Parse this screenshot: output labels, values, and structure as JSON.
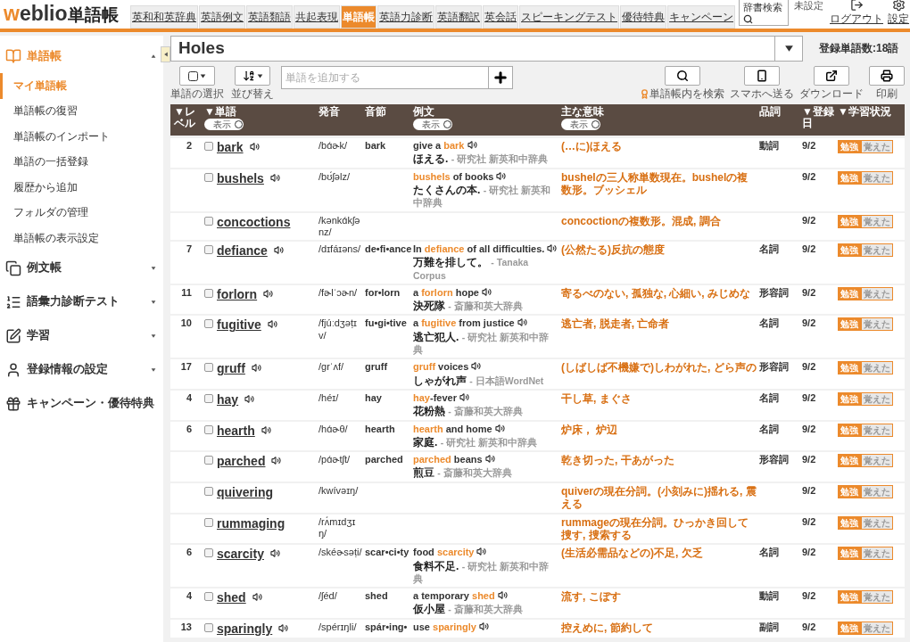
{
  "header": {
    "logo": {
      "accent": "w",
      "rest": "eblio",
      "suffix": "単語帳"
    },
    "tabs": [
      {
        "label": "英和和英辞典",
        "selected": false
      },
      {
        "label": "英語例文",
        "selected": false
      },
      {
        "label": "英語類語",
        "selected": false
      },
      {
        "label": "共起表現",
        "selected": false
      },
      {
        "label": "単語帳",
        "selected": true
      },
      {
        "label": "英語力診断",
        "selected": false
      },
      {
        "label": "英語翻訳",
        "selected": false
      },
      {
        "label": "英会話",
        "selected": false
      },
      {
        "label": "スピーキングテスト",
        "selected": false
      },
      {
        "label": "優待特典",
        "selected": false
      },
      {
        "label": "キャンペーン",
        "selected": false
      }
    ],
    "search_label": "辞書検索",
    "user": "未設定",
    "logout": "ログアウト",
    "settings": "設定"
  },
  "sidebar": {
    "sections": [
      {
        "label": "単語帳",
        "expanded": true,
        "items": [
          {
            "label": "マイ単語帳",
            "selected": true
          },
          {
            "label": "単語帳の復習",
            "selected": false
          },
          {
            "label": "単語帳のインポート",
            "selected": false
          },
          {
            "label": "単語の一括登録",
            "selected": false
          },
          {
            "label": "履歴から追加",
            "selected": false
          },
          {
            "label": "フォルダの管理",
            "selected": false
          },
          {
            "label": "単語帳の表示設定",
            "selected": false
          }
        ]
      },
      {
        "label": "例文帳",
        "expanded": false
      },
      {
        "label": "語彙力診断テスト",
        "expanded": false
      },
      {
        "label": "学習",
        "expanded": false
      },
      {
        "label": "登録情報の設定",
        "expanded": false
      },
      {
        "label": "キャンペーン・優待特典",
        "expanded": false
      }
    ]
  },
  "wordbook": {
    "name": "Holes",
    "count": "登録単語数:18語"
  },
  "toolbar": {
    "select_label": "単語の選択",
    "sort_label": "並び替え",
    "add_placeholder": "単語を追加する",
    "actions": [
      {
        "kind": "search",
        "label": "単語帳内を検索"
      },
      {
        "kind": "phone",
        "label": "スマホへ送る"
      },
      {
        "kind": "download",
        "label": "ダウンロード"
      },
      {
        "kind": "print",
        "label": "印刷"
      }
    ]
  },
  "table": {
    "columns": [
      {
        "label": "▼レベル"
      },
      {
        "label": "▼単語",
        "toggle": "表示",
        "toggle_on": true
      },
      {
        "label": "発音"
      },
      {
        "label": "音節"
      },
      {
        "label": "例文",
        "toggle": "表示",
        "toggle_on": true
      },
      {
        "label": "主な意味",
        "toggle": "表示",
        "toggle_on": true
      },
      {
        "label": "品詞"
      },
      {
        "label": "▼登録日"
      },
      {
        "label": "▼学習状況"
      }
    ],
    "rows": [
      {
        "level": "2",
        "word": "bark",
        "checked": false,
        "audio": true,
        "pron": "/bɑ́ɚk/",
        "syll": "bark",
        "example": {
          "before": "give a ",
          "hit": "bark",
          "translation": "ほえる.",
          "source": "- 研究社 新英和中辞典"
        },
        "meaning": "(…に)ほえる",
        "pos": "動詞",
        "date": "9/2",
        "status": [
          {
            "label": "勉強",
            "selected": true
          },
          {
            "label": "覚えた",
            "selected": false
          }
        ]
      },
      {
        "word": "bushels",
        "checked": false,
        "audio": true,
        "pron": "/bʊ́ʃəlz/",
        "example": {
          "hit": "bushels",
          "after": " of books",
          "translation": "たくさんの本.",
          "source": "- 研究社 新英和中辞典"
        },
        "meaning": "bushelの三人称単数現在。bushelの複数形。ブッシェル",
        "date": "9/2",
        "status": [
          {
            "label": "勉強",
            "selected": true
          },
          {
            "label": "覚えた",
            "selected": false
          }
        ]
      },
      {
        "word": "concoctions",
        "checked": false,
        "audio": false,
        "pron": "/kənkɑ́kʃənz/",
        "meaning": "concoctionの複数形。混成, 調合",
        "date": "9/2",
        "status": [
          {
            "label": "勉強",
            "selected": true
          },
          {
            "label": "覚えた",
            "selected": false
          }
        ]
      },
      {
        "level": "7",
        "word": "defiance",
        "checked": false,
        "audio": true,
        "pron": "/dɪfáɪəns/",
        "syll": "de•fi•ance",
        "example": {
          "before": "In ",
          "hit": "defiance",
          "after": " of all difficulties.",
          "translation": "万難を排して。",
          "source": "- Tanaka Corpus"
        },
        "meaning": "(公然たる)反抗の態度",
        "pos": "名詞",
        "date": "9/2",
        "status": [
          {
            "label": "勉強",
            "selected": true
          },
          {
            "label": "覚えた",
            "selected": false
          }
        ]
      },
      {
        "level": "11",
        "word": "forlorn",
        "checked": false,
        "audio": true,
        "pron": "/fɚlˈɔɚn/",
        "syll": "for•lorn",
        "example": {
          "before": "a ",
          "hit": "forlorn",
          "after": " hope",
          "translation": "決死隊",
          "source": "- 斎藤和英大辞典"
        },
        "meaning": "寄るべのない, 孤独な, 心細い, みじめな",
        "pos": "形容詞",
        "date": "9/2",
        "status": [
          {
            "label": "勉強",
            "selected": true
          },
          {
            "label": "覚えた",
            "selected": false
          }
        ]
      },
      {
        "level": "10",
        "word": "fugitive",
        "checked": false,
        "audio": true,
        "pron": "/fjúːdʒəṭɪv/",
        "syll": "fu•gi•tive",
        "example": {
          "before": "a ",
          "hit": "fugitive",
          "after": " from justice",
          "translation": "逃亡犯人.",
          "source": "- 研究社 新英和中辞典"
        },
        "meaning": "逃亡者, 脱走者, 亡命者",
        "pos": "名詞",
        "date": "9/2",
        "status": [
          {
            "label": "勉強",
            "selected": true
          },
          {
            "label": "覚えた",
            "selected": false
          }
        ]
      },
      {
        "level": "17",
        "word": "gruff",
        "checked": false,
        "audio": true,
        "pron": "/grˈʌf/",
        "syll": "gruff",
        "example": {
          "hit": "gruff",
          "after": " voices",
          "translation": "しゃがれ声",
          "source": "- 日本語WordNet"
        },
        "meaning": "(しばしば不機嫌で)しわがれた, どら声の",
        "pos": "形容詞",
        "date": "9/2",
        "status": [
          {
            "label": "勉強",
            "selected": true
          },
          {
            "label": "覚えた",
            "selected": false
          }
        ]
      },
      {
        "level": "4",
        "word": "hay",
        "checked": false,
        "audio": true,
        "pron": "/héɪ/",
        "syll": "hay",
        "example": {
          "hit": "hay",
          "after": "-fever",
          "translation": "花粉熱",
          "source": "- 斎藤和英大辞典"
        },
        "meaning": "干し草, まぐさ",
        "pos": "名詞",
        "date": "9/2",
        "status": [
          {
            "label": "勉強",
            "selected": true
          },
          {
            "label": "覚えた",
            "selected": false
          }
        ]
      },
      {
        "level": "6",
        "word": "hearth",
        "checked": false,
        "audio": true,
        "pron": "/hɑ́ɚθ/",
        "syll": "hearth",
        "example": {
          "hit": "hearth",
          "after": " and home",
          "translation": "家庭.",
          "source": "- 研究社 新英和中辞典"
        },
        "meaning": "炉床， 炉辺",
        "pos": "名詞",
        "date": "9/2",
        "status": [
          {
            "label": "勉強",
            "selected": true
          },
          {
            "label": "覚えた",
            "selected": false
          }
        ]
      },
      {
        "word": "parched",
        "checked": false,
        "audio": true,
        "pron": "/pɑ́ɚtʃt/",
        "syll": "parched",
        "example": {
          "hit": "parched",
          "after": " beans",
          "translation": "煎豆",
          "source": "- 斎藤和英大辞典"
        },
        "meaning": "乾き切った, 干あがった",
        "pos": "形容詞",
        "date": "9/2",
        "status": [
          {
            "label": "勉強",
            "selected": true
          },
          {
            "label": "覚えた",
            "selected": false
          }
        ]
      },
      {
        "word": "quivering",
        "checked": false,
        "audio": false,
        "pron": "/kwívəɪŋ/",
        "meaning": "quiverの現在分詞。(小刻みに)揺れる, 震える",
        "date": "9/2",
        "status": [
          {
            "label": "勉強",
            "selected": true
          },
          {
            "label": "覚えた",
            "selected": false
          }
        ]
      },
      {
        "word": "rummaging",
        "checked": false,
        "audio": false,
        "pron": "/rʌ́mɪdʒɪŋ/",
        "meaning": "rummageの現在分詞。ひっかき回して捜す, 捜索する",
        "date": "9/2",
        "status": [
          {
            "label": "勉強",
            "selected": true
          },
          {
            "label": "覚えた",
            "selected": false
          }
        ]
      },
      {
        "level": "6",
        "word": "scarcity",
        "checked": false,
        "audio": true,
        "pron": "/skéɚsəṭi/",
        "syll": "scar•ci•ty",
        "example": {
          "before": "food ",
          "hit": "scarcity",
          "translation": "食料不足.",
          "source": "- 研究社 新英和中辞典"
        },
        "meaning": "(生活必需品などの)不足, 欠乏",
        "pos": "名詞",
        "date": "9/2",
        "status": [
          {
            "label": "勉強",
            "selected": true
          },
          {
            "label": "覚えた",
            "selected": false
          }
        ]
      },
      {
        "level": "4",
        "word": "shed",
        "checked": false,
        "audio": true,
        "pron": "/ʃéd/",
        "syll": "shed",
        "example": {
          "before": "a temporary ",
          "hit": "shed",
          "translation": "仮小屋",
          "source": "- 斎藤和英大辞典"
        },
        "meaning": "流す, こぼす",
        "pos": "動詞",
        "date": "9/2",
        "status": [
          {
            "label": "勉強",
            "selected": true
          },
          {
            "label": "覚えた",
            "selected": false
          }
        ]
      },
      {
        "level": "13",
        "word": "sparingly",
        "checked": false,
        "audio": true,
        "pron": "/spérɪŋli/",
        "syll": "spár•ing•",
        "example": {
          "before": "use ",
          "hit": "sparingly"
        },
        "meaning": "控えめに, 節約して",
        "pos": "副詞",
        "date": "9/2",
        "status": [
          {
            "label": "勉強",
            "selected": true
          },
          {
            "label": "覚えた",
            "selected": false
          }
        ]
      }
    ]
  }
}
